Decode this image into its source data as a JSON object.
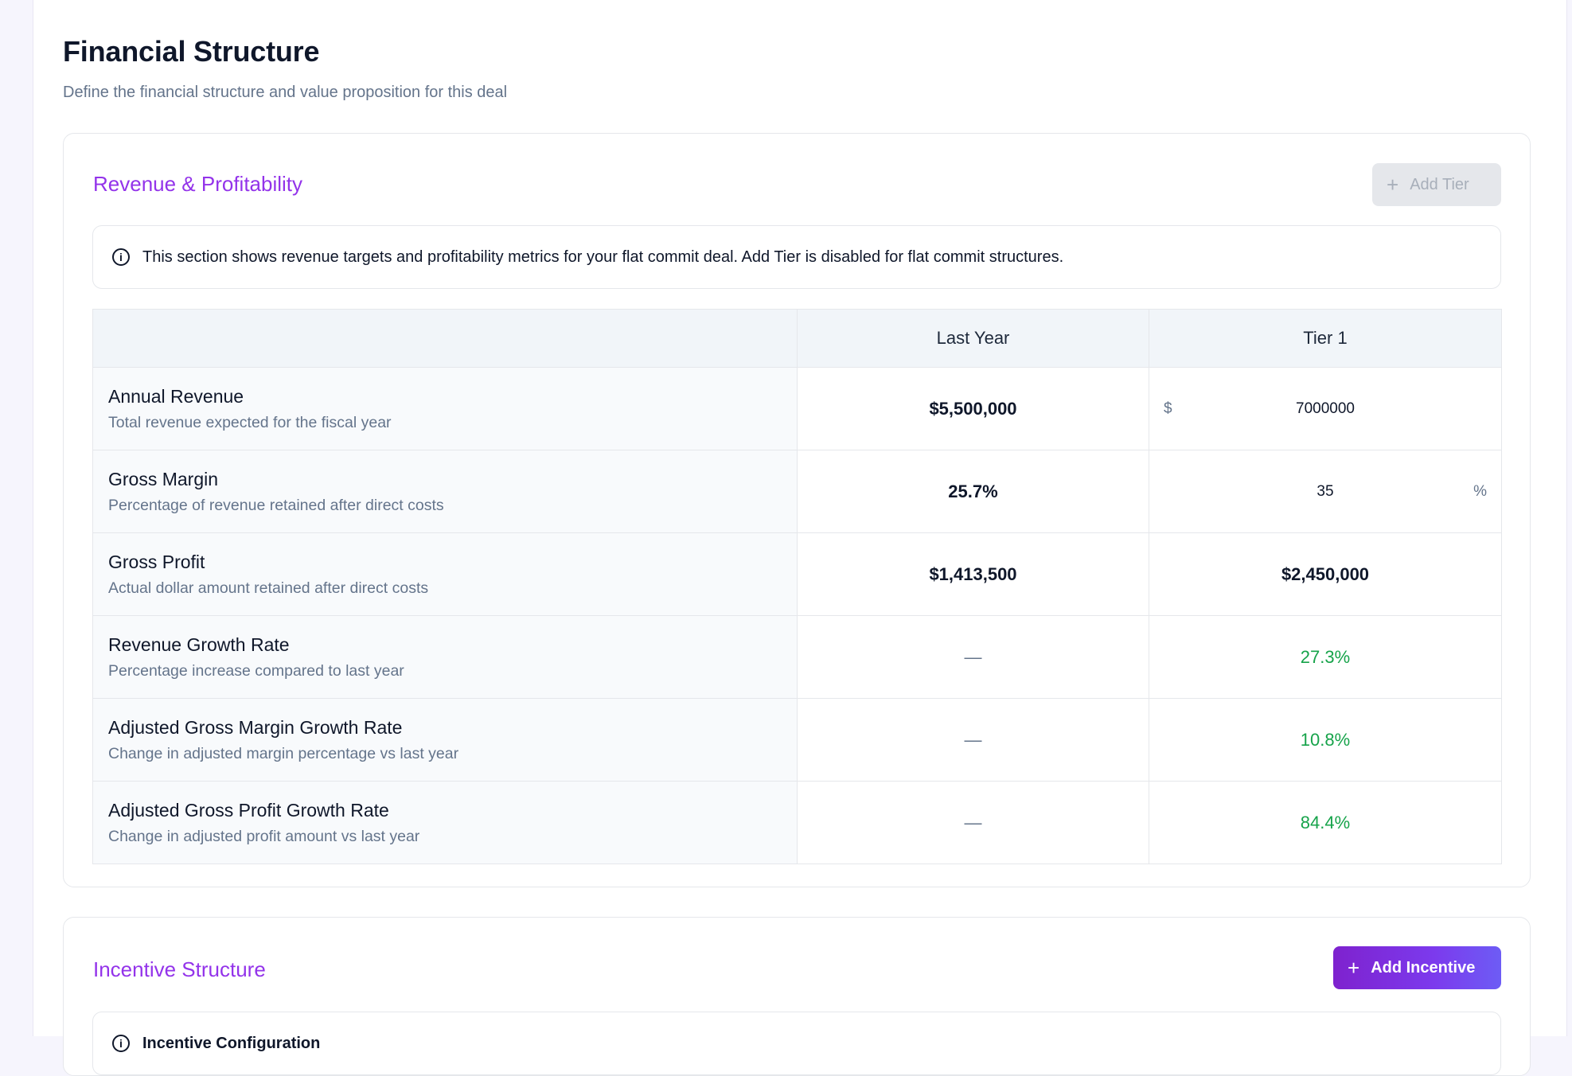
{
  "page": {
    "title": "Financial Structure",
    "subtitle": "Define the financial structure and value proposition for this deal"
  },
  "revenue_section": {
    "title": "Revenue & Profitability",
    "add_tier_label": "Add Tier",
    "add_tier_disabled": true,
    "info_text": "This section shows revenue targets and profitability metrics for your flat commit deal. Add Tier is disabled for flat commit structures.",
    "columns": [
      "",
      "Last Year",
      "Tier 1"
    ],
    "rows": [
      {
        "name": "Annual Revenue",
        "description": "Total revenue expected for the fiscal year",
        "last_year": "$5,500,000",
        "tier1_prefix": "$",
        "tier1_input": "7000000"
      },
      {
        "name": "Gross Margin",
        "description": "Percentage of revenue retained after direct costs",
        "last_year": "25.7%",
        "tier1_input": "35",
        "tier1_suffix": "%"
      },
      {
        "name": "Gross Profit",
        "description": "Actual dollar amount retained after direct costs",
        "last_year": "$1,413,500",
        "tier1": "$2,450,000"
      },
      {
        "name": "Revenue Growth Rate",
        "description": "Percentage increase compared to last year",
        "last_year": "—",
        "tier1": "27.3%"
      },
      {
        "name": "Adjusted Gross Margin Growth Rate",
        "description": "Change in adjusted margin percentage vs last year",
        "last_year": "—",
        "tier1": "10.8%"
      },
      {
        "name": "Adjusted Gross Profit Growth Rate",
        "description": "Change in adjusted profit amount vs last year",
        "last_year": "—",
        "tier1": "84.4%"
      }
    ]
  },
  "incentive_section": {
    "title": "Incentive Structure",
    "add_incentive_label": "Add Incentive",
    "info_text": "Incentive Configuration"
  },
  "colors": {
    "accent": "#9333ea",
    "growth_positive": "#16a34a",
    "button_gradient_start": "#7e22ce",
    "button_gradient_end": "#6d5cf5"
  },
  "icons": [
    "plus-icon",
    "info-circle-icon"
  ]
}
